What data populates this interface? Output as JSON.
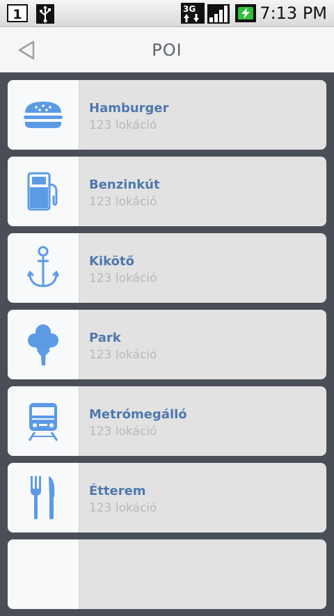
{
  "status_bar": {
    "notification_count": "1",
    "network_type": "3G",
    "time": "7:13 PM"
  },
  "header": {
    "title": "POI",
    "back_icon": "back-arrow-icon"
  },
  "poi_list": [
    {
      "label": "Hamburger",
      "count": "123 lokáció",
      "icon": "hamburger-icon"
    },
    {
      "label": "Benzinkút",
      "count": "123 lokáció",
      "icon": "gas-pump-icon"
    },
    {
      "label": "Kikötő",
      "count": "123 lokáció",
      "icon": "anchor-icon"
    },
    {
      "label": "Park",
      "count": "123 lokáció",
      "icon": "tree-icon"
    },
    {
      "label": "Metrómegálló",
      "count": "123 lokáció",
      "icon": "metro-train-icon"
    },
    {
      "label": "Étterem",
      "count": "123 lokáció",
      "icon": "fork-knife-icon"
    }
  ],
  "colors": {
    "accent": "#4f78ad",
    "icon_blue": "#5b9be6",
    "background": "#4a4f57"
  }
}
